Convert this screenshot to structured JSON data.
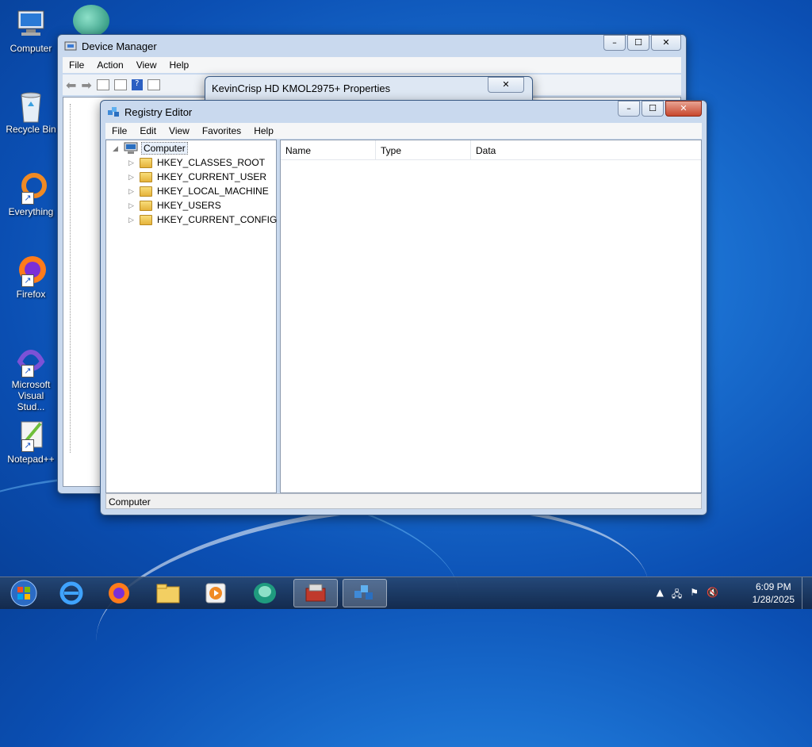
{
  "desktop": {
    "icons": [
      {
        "label": "Computer",
        "icon": "computer-icon"
      },
      {
        "label": "Recycle Bin",
        "icon": "recycle-bin-icon"
      },
      {
        "label": "Everything",
        "icon": "everything-icon"
      },
      {
        "label": "Firefox",
        "icon": "firefox-icon"
      },
      {
        "label": "Microsoft Visual Stud...",
        "icon": "visual-studio-icon"
      },
      {
        "label": "Notepad++",
        "icon": "notepadpp-icon"
      }
    ]
  },
  "device_manager": {
    "title": "Device Manager",
    "menu": [
      "File",
      "Action",
      "View",
      "Help"
    ],
    "controls": {
      "minimize": "–",
      "maximize": "☐",
      "close": "✕"
    }
  },
  "properties_dialog": {
    "title": "KevinCrisp HD KMOL2975+ Properties",
    "close": "✕"
  },
  "registry_editor": {
    "title": "Registry Editor",
    "menu": [
      "File",
      "Edit",
      "View",
      "Favorites",
      "Help"
    ],
    "controls": {
      "minimize": "–",
      "maximize": "☐",
      "close": "✕"
    },
    "tree": {
      "root": "Computer",
      "keys": [
        "HKEY_CLASSES_ROOT",
        "HKEY_CURRENT_USER",
        "HKEY_LOCAL_MACHINE",
        "HKEY_USERS",
        "HKEY_CURRENT_CONFIG"
      ]
    },
    "columns": [
      "Name",
      "Type",
      "Data"
    ],
    "status": "Computer"
  },
  "taskbar": {
    "apps": [
      "start-orb",
      "internet-explorer-icon",
      "firefox-icon",
      "file-explorer-icon",
      "media-player-icon",
      "app-icon",
      "device-manager-icon",
      "registry-editor-icon"
    ],
    "time": "6:09 PM",
    "date": "1/28/2025"
  },
  "colors": {
    "accent": "#1a6fd0",
    "close_button": "#c7472d"
  }
}
